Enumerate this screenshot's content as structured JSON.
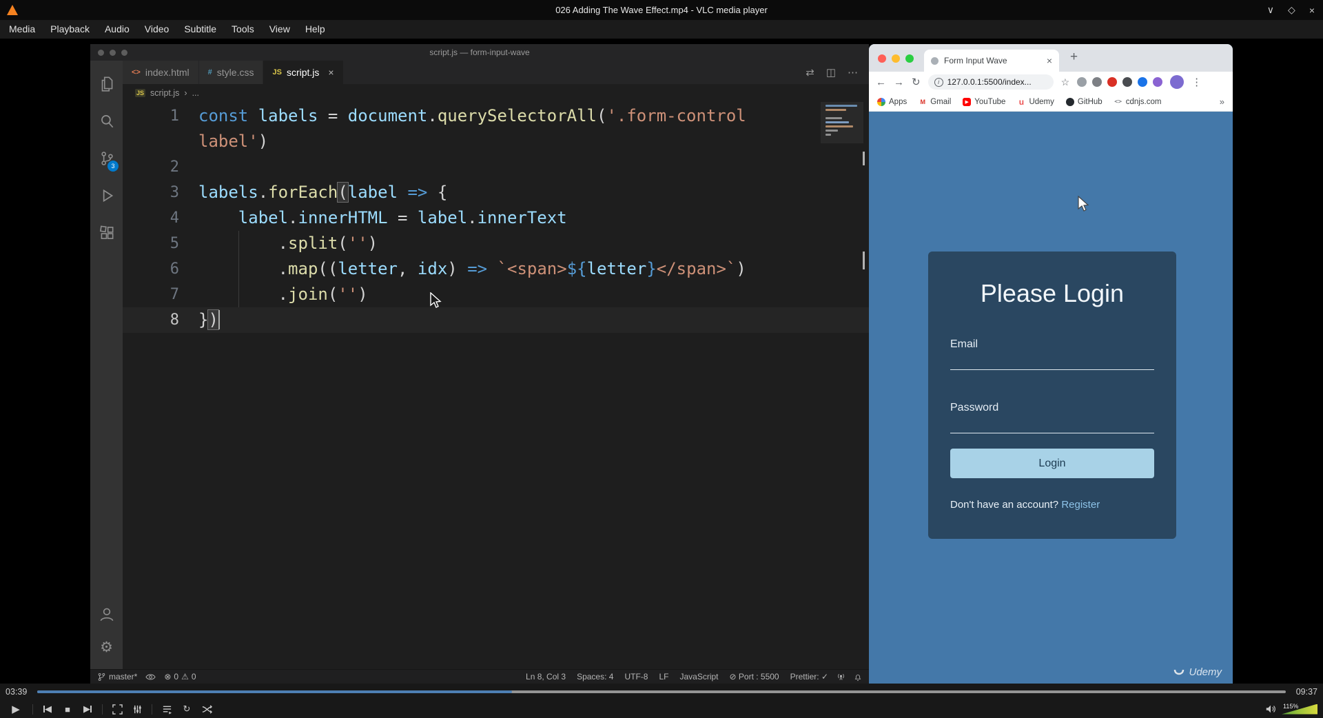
{
  "vlc": {
    "window_title": "026 Adding The Wave Effect.mp4 - VLC media player",
    "menu_items": [
      "Media",
      "Playback",
      "Audio",
      "Video",
      "Subtitle",
      "Tools",
      "View",
      "Help"
    ],
    "window_buttons": {
      "minimize": "∨",
      "restore": "◇",
      "close": "×"
    },
    "time_elapsed": "03:39",
    "time_total": "09:37",
    "progress_percent": 38,
    "volume_label": "115%"
  },
  "vscode": {
    "window_title": "script.js — form-input-wave",
    "tabs": [
      {
        "label": "index.html"
      },
      {
        "label": "style.css"
      },
      {
        "label": "script.js"
      }
    ],
    "tab_actions": [
      "⇄",
      "◫",
      "⋯"
    ],
    "breadcrumb": {
      "file": "script.js",
      "ellipsis": "..."
    },
    "scm_badge": "3",
    "code_rows": [
      {
        "num": "1",
        "tokens": [
          {
            "t": "const ",
            "c": "kw"
          },
          {
            "t": "labels",
            "c": "vr"
          },
          {
            "t": " = ",
            "c": "pl"
          },
          {
            "t": "document",
            "c": "vr"
          },
          {
            "t": ".",
            "c": "pl"
          },
          {
            "t": "querySelectorAll",
            "c": "fn"
          },
          {
            "t": "(",
            "c": "pl"
          },
          {
            "t": "'.form-control",
            "c": "st"
          }
        ]
      },
      {
        "num": "",
        "tokens": [
          {
            "t": "label'",
            "c": "st"
          },
          {
            "t": ")",
            "c": "pl"
          }
        ]
      },
      {
        "num": "2",
        "tokens": []
      },
      {
        "num": "3",
        "tokens": [
          {
            "t": "labels",
            "c": "vr"
          },
          {
            "t": ".",
            "c": "pl"
          },
          {
            "t": "forEach",
            "c": "fn"
          },
          {
            "t": "(",
            "c": "pl mb"
          },
          {
            "t": "label",
            "c": "vr"
          },
          {
            "t": " ",
            "c": "pl"
          },
          {
            "t": "=>",
            "c": "kw"
          },
          {
            "t": " {",
            "c": "pl"
          }
        ]
      },
      {
        "num": "4",
        "tokens": [
          {
            "t": "    ",
            "c": "pl"
          },
          {
            "t": "label",
            "c": "vr"
          },
          {
            "t": ".",
            "c": "pl"
          },
          {
            "t": "innerHTML",
            "c": "vr"
          },
          {
            "t": " = ",
            "c": "pl"
          },
          {
            "t": "label",
            "c": "vr"
          },
          {
            "t": ".",
            "c": "pl"
          },
          {
            "t": "innerText",
            "c": "vr"
          }
        ]
      },
      {
        "num": "5",
        "tokens": [
          {
            "t": "        ",
            "c": "pl"
          },
          {
            "t": ".",
            "c": "pl"
          },
          {
            "t": "split",
            "c": "fn"
          },
          {
            "t": "(",
            "c": "pl"
          },
          {
            "t": "''",
            "c": "st"
          },
          {
            "t": ")",
            "c": "pl"
          }
        ]
      },
      {
        "num": "6",
        "tokens": [
          {
            "t": "        ",
            "c": "pl"
          },
          {
            "t": ".",
            "c": "pl"
          },
          {
            "t": "map",
            "c": "fn"
          },
          {
            "t": "((",
            "c": "pl"
          },
          {
            "t": "letter",
            "c": "vr"
          },
          {
            "t": ", ",
            "c": "pl"
          },
          {
            "t": "idx",
            "c": "vr"
          },
          {
            "t": ") ",
            "c": "pl"
          },
          {
            "t": "=>",
            "c": "kw"
          },
          {
            "t": " ",
            "c": "pl"
          },
          {
            "t": "`<span>",
            "c": "st"
          },
          {
            "t": "${",
            "c": "kw"
          },
          {
            "t": "letter",
            "c": "vr"
          },
          {
            "t": "}",
            "c": "kw"
          },
          {
            "t": "</span>`",
            "c": "st"
          },
          {
            "t": ")",
            "c": "pl"
          }
        ]
      },
      {
        "num": "7",
        "tokens": [
          {
            "t": "        ",
            "c": "pl"
          },
          {
            "t": ".",
            "c": "pl"
          },
          {
            "t": "join",
            "c": "fn"
          },
          {
            "t": "(",
            "c": "pl"
          },
          {
            "t": "''",
            "c": "st"
          },
          {
            "t": ")",
            "c": "pl"
          }
        ]
      },
      {
        "num": "8",
        "tokens": [
          {
            "t": "}",
            "c": "pl"
          },
          {
            "t": ")",
            "c": "pl mb"
          }
        ]
      }
    ],
    "status": {
      "branch": "master*",
      "error_count": "0",
      "warning_count": "0",
      "right_items": [
        "Ln 8, Col 3",
        "Spaces: 4",
        "UTF-8",
        "LF",
        "JavaScript",
        "⊘ Port : 5500",
        "Prettier: ✓"
      ]
    }
  },
  "browser": {
    "tab_title": "Form Input Wave",
    "url": "127.0.0.1:5500/index...",
    "bookmarks_overflow": "»",
    "bookmarks": [
      {
        "label": "Apps",
        "icon": "apps"
      },
      {
        "label": "Gmail",
        "icon": "gmail"
      },
      {
        "label": "YouTube",
        "icon": "youtube"
      },
      {
        "label": "Udemy",
        "icon": "udemy"
      },
      {
        "label": "GitHub",
        "icon": "github"
      },
      {
        "label": "cdnjs.com",
        "icon": "cdnjs"
      }
    ],
    "extension_icon_colors": [
      "#9aa0a6",
      "#7d8085",
      "#d93025",
      "#494c50",
      "#1a73e8",
      "#8a63d2"
    ],
    "page": {
      "heading": "Please Login",
      "email_label": "Email",
      "password_label": "Password",
      "email_value": "",
      "password_value": "",
      "login_button": "Login",
      "register_text": "Don't have an account?",
      "register_link": "Register"
    },
    "watermark": "Udemy"
  },
  "colors": {
    "vscode_badge_blue": "#007acc",
    "page_background": "#4478a9",
    "card_background": "#2a4761",
    "login_button_blue": "#a8d2e7",
    "vlc_cone_orange": "#f58220",
    "seek_progress_blue": "#4d7fb3"
  }
}
